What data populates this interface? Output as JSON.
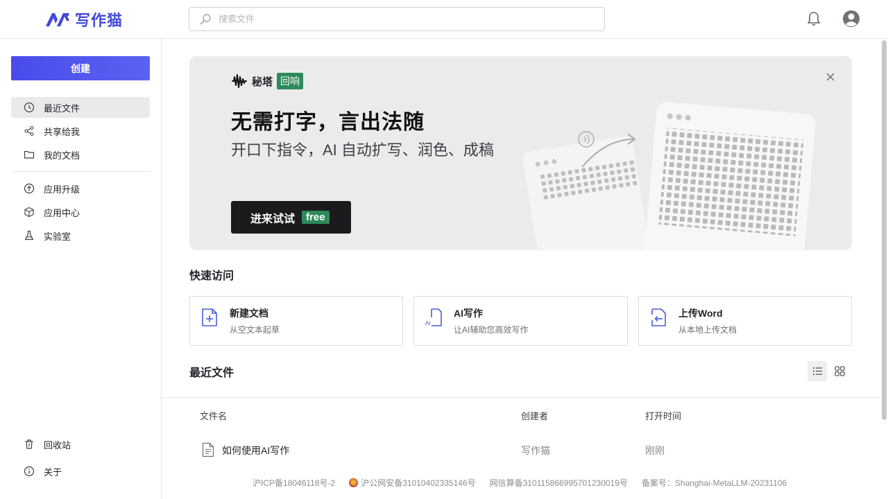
{
  "header": {
    "logo_text": "写作猫",
    "search_placeholder": "搜索文件"
  },
  "sidebar": {
    "create_label": "创建",
    "nav_main": [
      {
        "label": "最近文件",
        "icon": "clock-icon",
        "active": true
      },
      {
        "label": "共享给我",
        "icon": "share-icon",
        "active": false
      },
      {
        "label": "我的文档",
        "icon": "folder-icon",
        "active": false
      }
    ],
    "nav_apps": [
      {
        "label": "应用升级",
        "icon": "upgrade-icon"
      },
      {
        "label": "应用中心",
        "icon": "cube-icon"
      },
      {
        "label": "实验室",
        "icon": "flask-icon"
      }
    ],
    "nav_bottom": [
      {
        "label": "回收站",
        "icon": "trash-icon"
      },
      {
        "label": "关于",
        "icon": "info-icon"
      }
    ]
  },
  "banner": {
    "brand_name": "秘塔",
    "brand_tag": "回响",
    "title": "无需打字，言出法随",
    "subtitle": "开口下指令，AI 自动扩写、润色、成稿",
    "button_label": "进来试试",
    "button_tag": "free"
  },
  "quick_access": {
    "title": "快速访问",
    "cards": [
      {
        "title": "新建文档",
        "desc": "从空文本起草",
        "icon": "new-doc-icon"
      },
      {
        "title": "AI写作",
        "desc": "让AI辅助您高效写作",
        "icon": "ai-doc-icon"
      },
      {
        "title": "上传Word",
        "desc": "从本地上传文档",
        "icon": "upload-doc-icon"
      }
    ]
  },
  "recent": {
    "title": "最近文件",
    "columns": [
      "文件名",
      "创建者",
      "打开时间"
    ],
    "rows": [
      {
        "name": "如何使用AI写作",
        "creator": "写作猫",
        "time": "刚刚"
      }
    ]
  },
  "footer": {
    "icp": "沪ICP备18046118号-2",
    "police": "沪公网安备31010402335146号",
    "algo": "网信算备310115866995701230019号",
    "record": "备案号：Shanghai-MetaLLM-20231106"
  },
  "colors": {
    "accent": "#4a4bea",
    "tag_green": "#2e8a5a",
    "icon_blue": "#4a5bd8"
  }
}
